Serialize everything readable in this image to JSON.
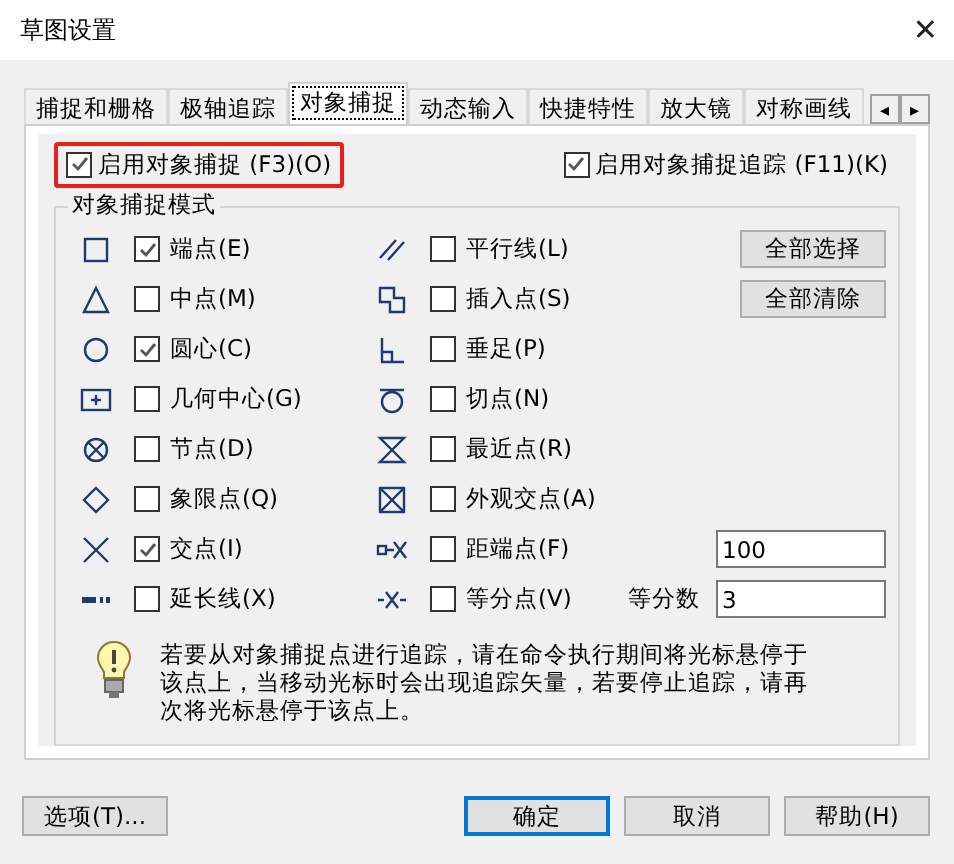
{
  "window": {
    "title": "草图设置",
    "close": "✕"
  },
  "tabs": [
    {
      "label": "捕捉和栅格",
      "selected": false
    },
    {
      "label": "极轴追踪",
      "selected": false
    },
    {
      "label": "对象捕捉",
      "selected": true
    },
    {
      "label": "动态输入",
      "selected": false
    },
    {
      "label": "快捷特性",
      "selected": false
    },
    {
      "label": "放大镜",
      "selected": false
    },
    {
      "label": "对称画线",
      "selected": false
    }
  ],
  "tab_scroll": [
    "◂",
    "▸"
  ],
  "enable_snap": {
    "label": "启用对象捕捉 (F3)(O)",
    "checked": true,
    "highlighted": true
  },
  "enable_tracking": {
    "label": "启用对象捕捉追踪 (F11)(K)",
    "checked": true
  },
  "group": {
    "title": "对象捕捉模式",
    "left": [
      {
        "kind": "square",
        "label": "端点(E)",
        "checked": true
      },
      {
        "kind": "triangle",
        "label": "中点(M)",
        "checked": false
      },
      {
        "kind": "circle",
        "label": "圆心(C)",
        "checked": true
      },
      {
        "kind": "plusbox",
        "label": "几何中心(G)",
        "checked": false
      },
      {
        "kind": "node",
        "label": "节点(D)",
        "checked": false
      },
      {
        "kind": "diamond",
        "label": "象限点(Q)",
        "checked": false
      },
      {
        "kind": "cross",
        "label": "交点(I)",
        "checked": true
      },
      {
        "kind": "extension",
        "label": "延长线(X)",
        "checked": false
      }
    ],
    "right": [
      {
        "kind": "parallel",
        "label": "平行线(L)",
        "checked": false
      },
      {
        "kind": "insertion",
        "label": "插入点(S)",
        "checked": false
      },
      {
        "kind": "perpendicular",
        "label": "垂足(P)",
        "checked": false
      },
      {
        "kind": "tangent",
        "label": "切点(N)",
        "checked": false
      },
      {
        "kind": "nearest",
        "label": "最近点(R)",
        "checked": false
      },
      {
        "kind": "apparent",
        "label": "外观交点(A)",
        "checked": false
      },
      {
        "kind": "distance",
        "label": "距端点(F)",
        "checked": false,
        "field": {
          "value": "100"
        }
      },
      {
        "kind": "divide",
        "label": "等分点(V)",
        "checked": false,
        "field": {
          "label": "等分数",
          "value": "3"
        }
      }
    ],
    "buttons": [
      "全部选择",
      "全部清除"
    ],
    "hint": "若要从对象捕捉点进行追踪，请在命令执行期间将光标悬停于该点上，当移动光标时会出现追踪矢量，若要停止追踪，请再次将光标悬停于该点上。"
  },
  "footer": {
    "options": "选项(T)...",
    "buttons": [
      {
        "label": "确定",
        "default": true
      },
      {
        "label": "取消",
        "default": false
      },
      {
        "label": "帮助(H)",
        "default": false
      }
    ]
  }
}
